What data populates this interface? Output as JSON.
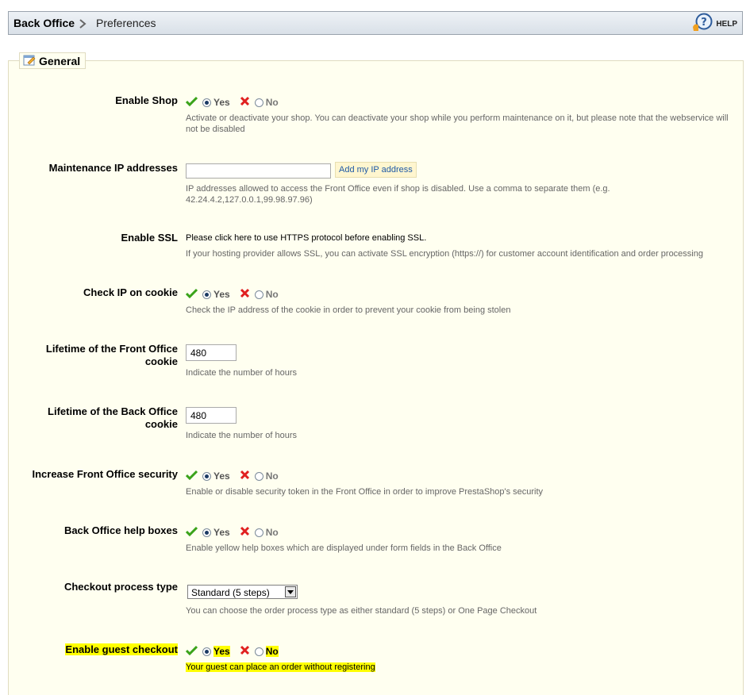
{
  "breadcrumb": {
    "home": "Back Office",
    "current": "Preferences"
  },
  "help": {
    "label": "HELP"
  },
  "fieldset": {
    "legend": "General"
  },
  "toggle": {
    "yes": "Yes",
    "no": "No"
  },
  "fields": {
    "enable_shop": {
      "label": "Enable Shop",
      "hint": "Activate or deactivate your shop. You can deactivate your shop while you perform maintenance on it, but please note that the webservice will not be disabled"
    },
    "maintenance_ip": {
      "label": "Maintenance IP addresses",
      "value": "",
      "button": "Add my IP address",
      "hint": "IP addresses allowed to access the Front Office even if shop is disabled. Use a comma to separate them (e.g. 42.24.4.2,127.0.0.1,99.98.97.96)"
    },
    "enable_ssl": {
      "label": "Enable SSL",
      "link": "Please click here to use HTTPS protocol before enabling SSL.",
      "hint": "If your hosting provider allows SSL, you can activate SSL encryption (https://) for customer account identification and order processing"
    },
    "check_ip_cookie": {
      "label": "Check IP on cookie",
      "hint": "Check the IP address of the cookie in order to prevent your cookie from being stolen"
    },
    "front_cookie": {
      "label": "Lifetime of the Front Office cookie",
      "value": "480",
      "hint": "Indicate the number of hours"
    },
    "back_cookie": {
      "label": "Lifetime of the Back Office cookie",
      "value": "480",
      "hint": "Indicate the number of hours"
    },
    "front_security": {
      "label": "Increase Front Office security",
      "hint": "Enable or disable security token in the Front Office in order to improve PrestaShop's security"
    },
    "help_boxes": {
      "label": "Back Office help boxes",
      "hint": "Enable yellow help boxes which are displayed under form fields in the Back Office"
    },
    "checkout_type": {
      "label": "Checkout process type",
      "selected": "Standard (5 steps)",
      "hint": "You can choose the order process type as either standard (5 steps) or One Page Checkout"
    },
    "guest_checkout": {
      "label": "Enable guest checkout",
      "hint": "Your guest can place an order without registering"
    }
  },
  "colors": {
    "highlight": "#ffff00",
    "panel_bg": "#fffff0",
    "yes_check": "#3aa31a",
    "no_cross": "#e02020",
    "link": "#1f5aa6"
  }
}
